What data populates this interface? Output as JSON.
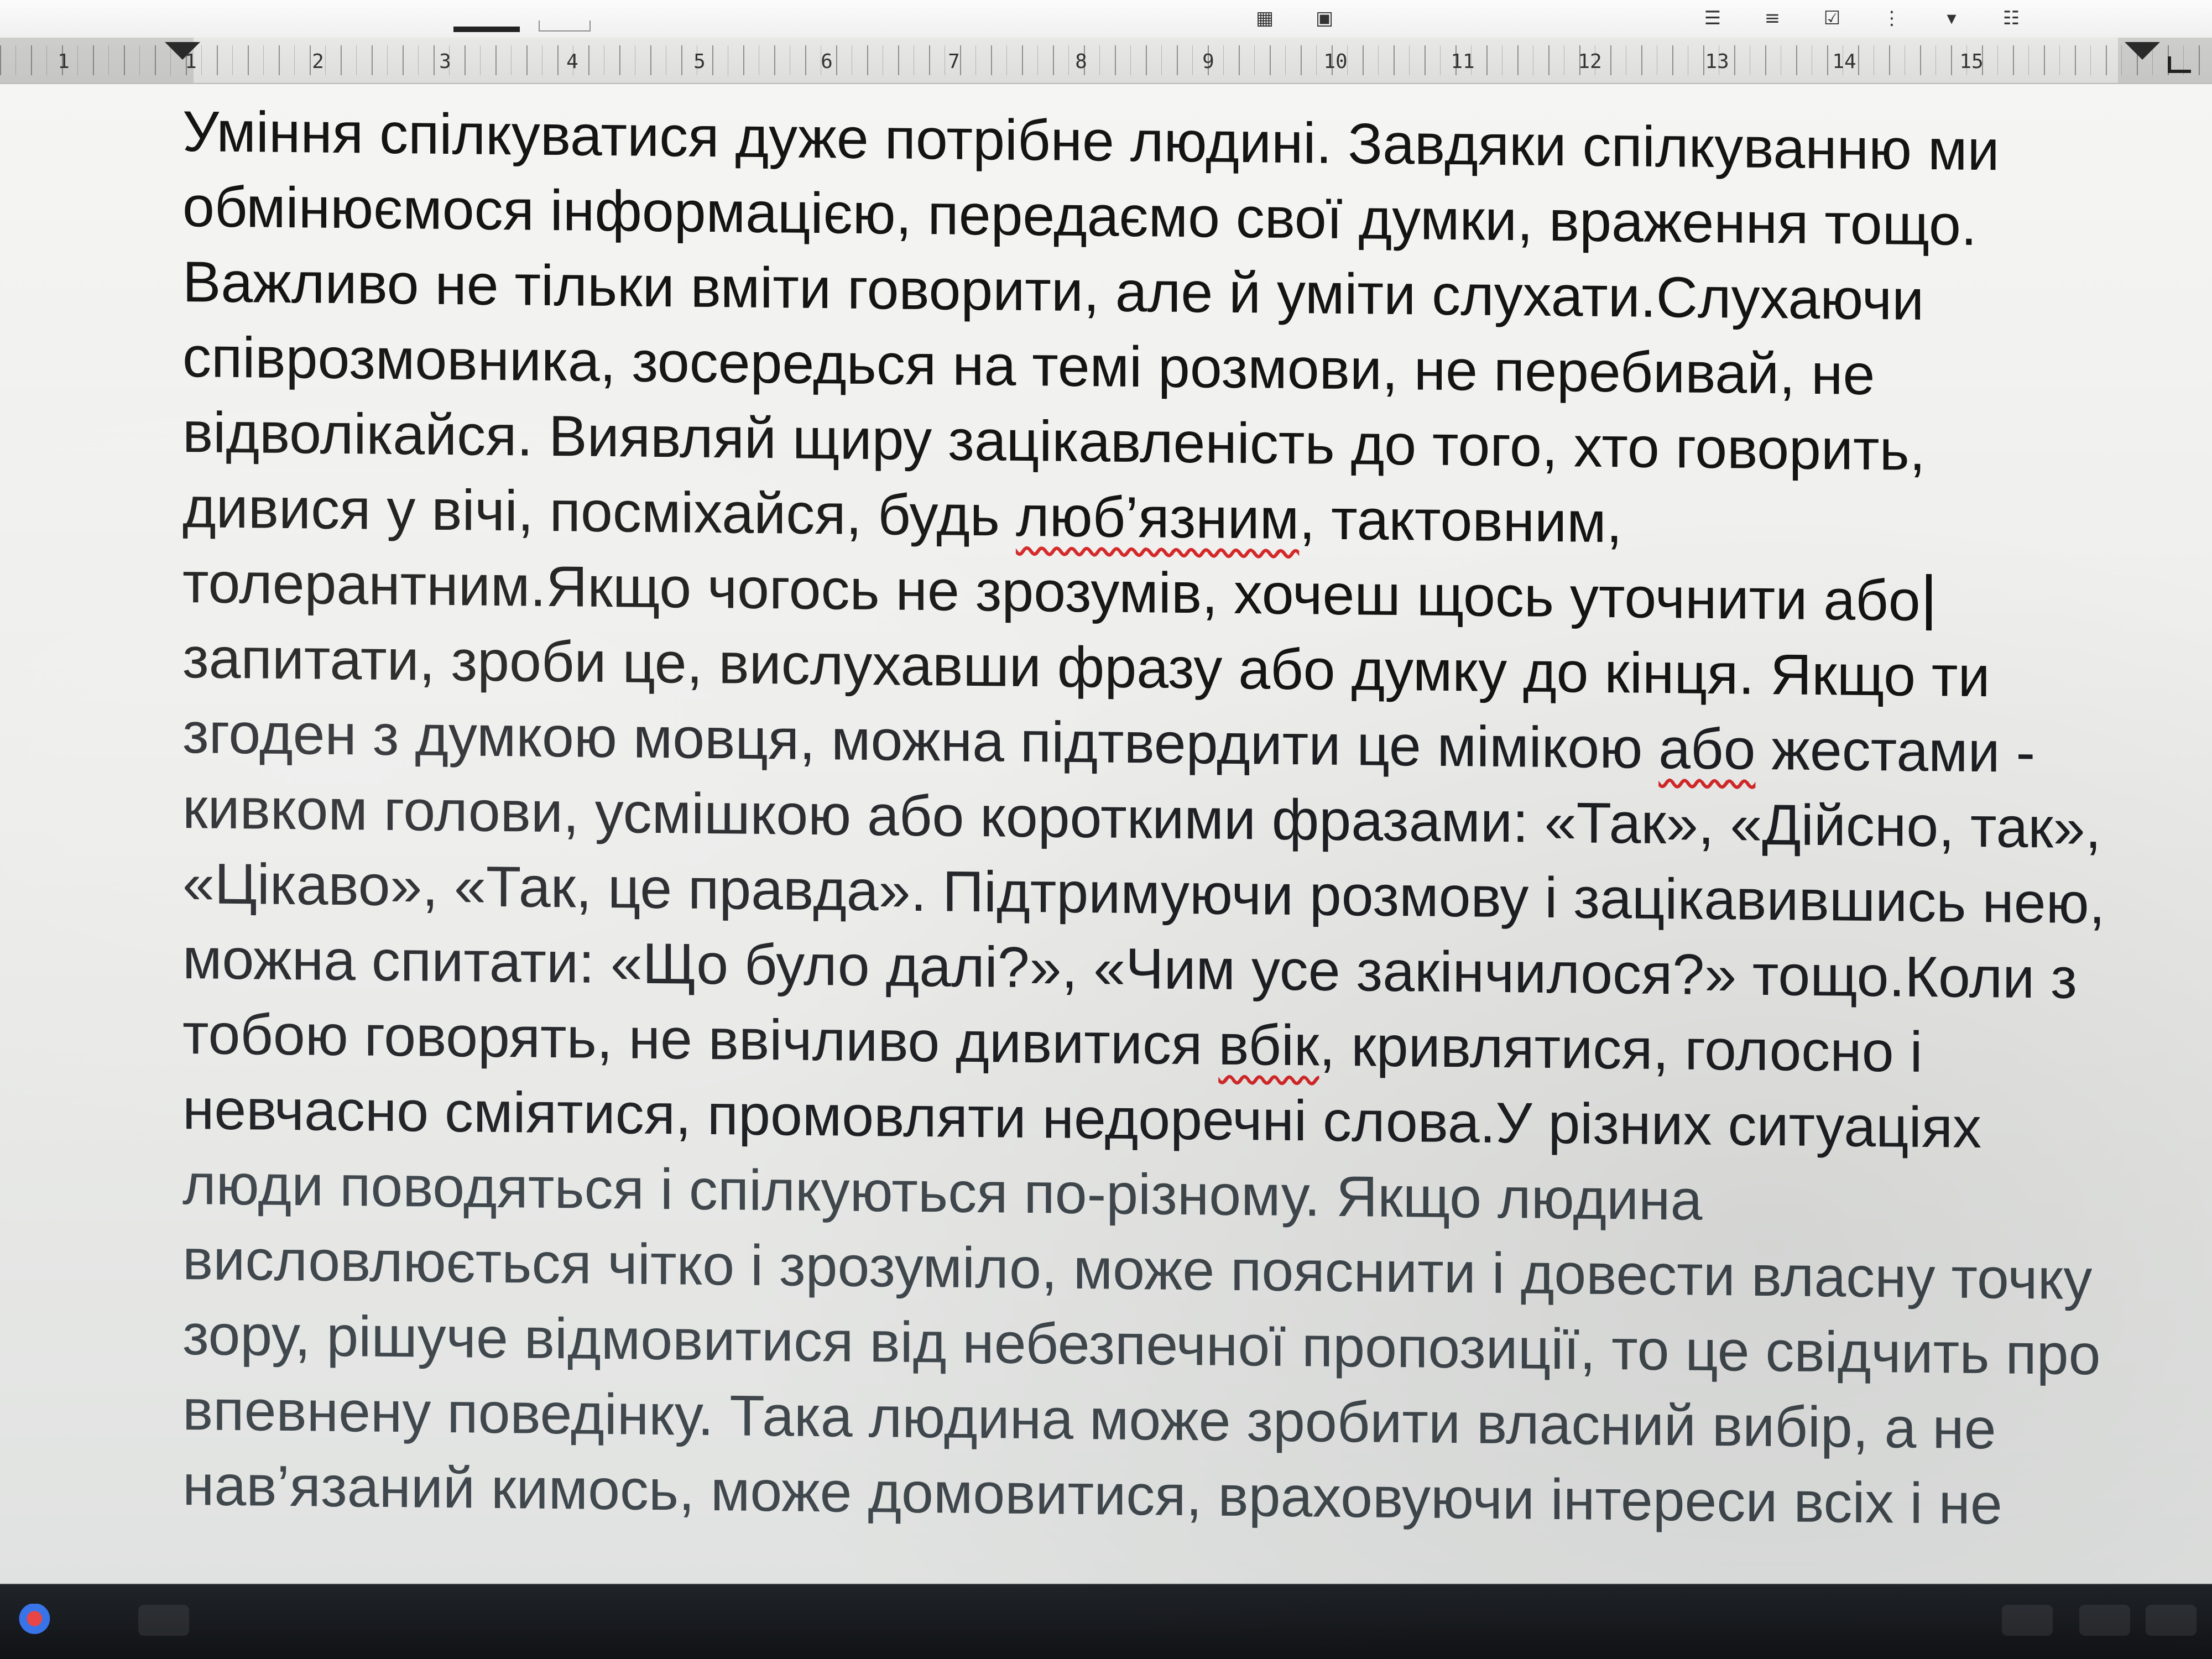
{
  "toolbar": {
    "icons": [
      "format-line-icon",
      "underline-color-icon",
      "table-icon",
      "bordered-box-icon",
      "line-spacing-icon",
      "numbered-list-icon",
      "checklist-icon",
      "bulleted-list-icon",
      "dropdown-arrow-icon",
      "multilevel-list-icon"
    ]
  },
  "ruler": {
    "numbers": [
      "1",
      "1",
      "2",
      "3",
      "4",
      "5",
      "6",
      "7",
      "8",
      "9",
      "10",
      "11",
      "12",
      "13",
      "14",
      "15"
    ]
  },
  "document": {
    "lines": [
      "Уміння спілкуватися дуже потрібне людині. Завдяки спілкуванню ми",
      "обмінюємося інформацією, передаємо свої думки, враження тощо.",
      "Важливо не тільки вміти говорити, але й уміти слухати.Слухаючи",
      "співрозмовника, зосередься на темі розмови, не перебивай, не",
      "відволікайся. Виявляй щиру зацікавленість до того, хто говорить,",
      "дивися у вічі, посміхайся, будь люб’язним, тактовним,",
      "толерантним.Якщо чогось не зрозумів, хочеш щось уточнити або",
      "запитати, зроби це, вислухавши фразу або думку до кінця. Якщо ти",
      "згоден з думкою мовця, можна підтвердити це мімікою або жестами -",
      "кивком голови, усмішкою або короткими фразами: «Так», «Дійсно, так»,",
      "«Цікаво», «Так, це правда». Підтримуючи розмову і зацікавившись нею,",
      "можна спитати: «Що було далі?», «Чим усе закінчилося?» тощо.Коли з",
      "тобою говорять, не ввічливо дивитися вбік, кривлятися, голосно і",
      "невчасно сміятися, промовляти недоречні слова.У різних ситуаціях",
      "люди поводяться і спілкуються по-різному. Якщо людина",
      "висловлюється чітко і зрозуміло, може пояснити і довести власну точку",
      "зору, рішуче відмовитися від небезпечної пропозиції, то це свідчить про",
      "впевнену поведінку. Така людина може зробити власний вибір, а не",
      "нав’язаний кимось, може домовитися, враховуючи інтереси всіх і не"
    ],
    "spelling_flags": [
      "люб’язним",
      "або",
      "вбік"
    ]
  },
  "taskbar": {
    "icons": [
      "windows-start-icon",
      "app-icon",
      "system-icon",
      "network-icon",
      "volume-icon"
    ]
  }
}
